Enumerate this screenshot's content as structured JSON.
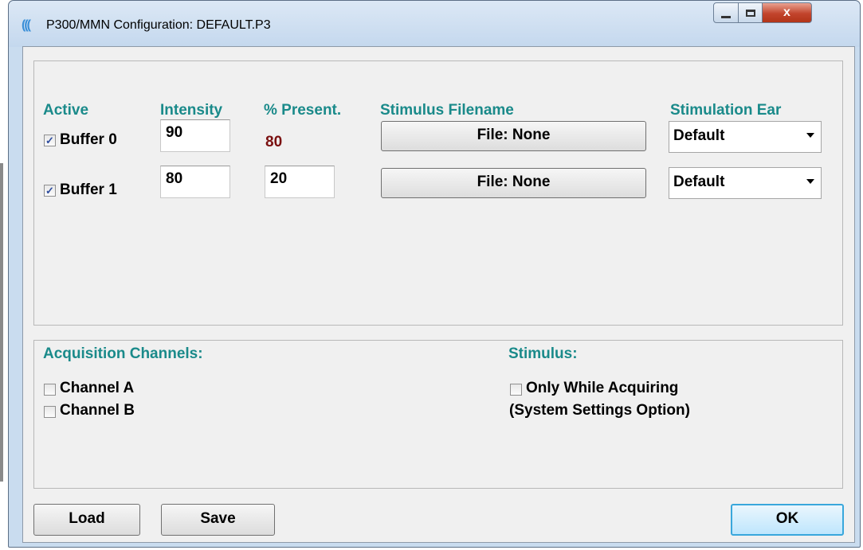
{
  "window": {
    "title": "P300/MMN Configuration: DEFAULT.P3",
    "icon": "sound-wave-icon",
    "controls": {
      "close_glyph": "x"
    }
  },
  "buffers_panel": {
    "headers": {
      "active": "Active",
      "intensity": "Intensity",
      "percent_present": "% Present.",
      "stimulus_filename": "Stimulus Filename",
      "stimulation_ear": "Stimulation Ear"
    },
    "rows": [
      {
        "label": "Buffer 0",
        "checked": true,
        "intensity": "90",
        "percent_present": "80",
        "file_button": "File: None",
        "ear": "Default"
      },
      {
        "label": "Buffer 1",
        "checked": true,
        "intensity": "80",
        "percent_present": "20",
        "file_button": "File: None",
        "ear": "Default"
      }
    ]
  },
  "options_panel": {
    "acquisition_heading": "Acquisition Channels:",
    "channels": [
      {
        "label": "Channel A",
        "checked": false
      },
      {
        "label": "Channel B",
        "checked": false
      }
    ],
    "stimulus_heading": "Stimulus:",
    "only_while_acquiring": {
      "label": "Only While Acquiring",
      "checked": false
    },
    "system_settings_note": "(System Settings Option)"
  },
  "footer": {
    "load_label": "Load",
    "save_label": "Save",
    "ok_label": "OK"
  },
  "colors": {
    "header_teal": "#1a8a8a",
    "static_value_red": "#7a1010",
    "ok_border": "#39a7dc",
    "close_red": "#c2442c"
  },
  "checkmark_glyph": "✓"
}
